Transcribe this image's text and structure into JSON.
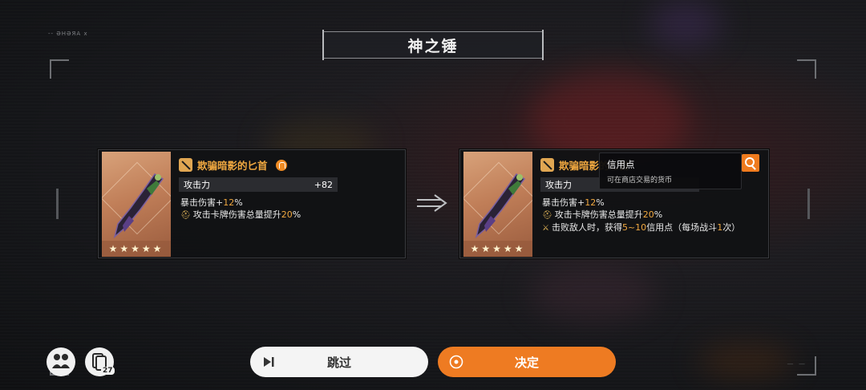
{
  "title": "神之锤",
  "header_strip": "-- ƏHƏЯA  x",
  "left_card": {
    "weapon_name": "欺骗暗影的匕首",
    "stars": "★★★★★",
    "stat_label": "攻击力",
    "stat_value": "+82",
    "effect1_prefix": "暴击伤害+",
    "effect1_value": "12",
    "effect1_suffix": "%",
    "effect2_prefix": "攻击卡牌伤害总量提升",
    "effect2_value": "20",
    "effect2_suffix": "%"
  },
  "right_card": {
    "weapon_name": "欺骗暗影的匕首",
    "stars": "★★★★★",
    "stat_label": "攻击力",
    "effect1_prefix": "暴击伤害+",
    "effect1_value": "12",
    "effect1_suffix": "%",
    "effect2_prefix": "攻击卡牌伤害总量提升",
    "effect2_value": "20",
    "effect2_suffix": "%",
    "effect3_prefix": "击败敌人时，获得",
    "effect3_value": "5~10",
    "effect3_mid": "信用点（每场战斗",
    "effect3_count": "1",
    "effect3_suffix": "次）"
  },
  "tooltip": {
    "title": "信用点",
    "description": "可在商店交易的货币"
  },
  "bottom": {
    "deck_count": "27",
    "skip_label": "跳过",
    "confirm_label": "决定"
  },
  "colors": {
    "accent": "#ee7b22",
    "highlight": "#f0a840"
  }
}
